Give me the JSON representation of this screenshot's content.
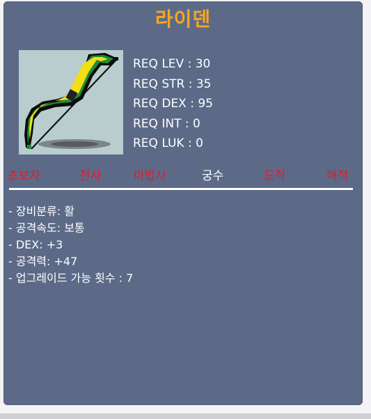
{
  "item": {
    "name": "라이덴",
    "image_icon": "bow-icon",
    "requirements": [
      {
        "label": "REQ LEV",
        "value": "30",
        "text": "REQ LEV : 30"
      },
      {
        "label": "REQ STR",
        "value": "35",
        "text": "REQ STR : 35"
      },
      {
        "label": "REQ DEX",
        "value": "95",
        "text": "REQ DEX : 95"
      },
      {
        "label": "REQ INT",
        "value": "0",
        "text": "REQ INT : 0"
      },
      {
        "label": "REQ LUK",
        "value": "0",
        "text": "REQ LUK : 0"
      }
    ],
    "jobs": [
      {
        "label": "초보자",
        "active": false
      },
      {
        "label": "전사",
        "active": false
      },
      {
        "label": "마법사",
        "active": false
      },
      {
        "label": "궁수",
        "active": true
      },
      {
        "label": "도적",
        "active": false
      },
      {
        "label": "해적",
        "active": false
      }
    ],
    "description": [
      "- 장비분류: 활",
      "- 공격속도: 보통",
      "- DEX: +3",
      "- 공격력: +47",
      "- 업그레이드 가능 횟수 : 7"
    ]
  },
  "colors": {
    "title": "#f5a623",
    "panel": "#5c6a88",
    "job_inactive": "#e8182a",
    "job_active": "#ffffff",
    "text": "#ffffff"
  }
}
